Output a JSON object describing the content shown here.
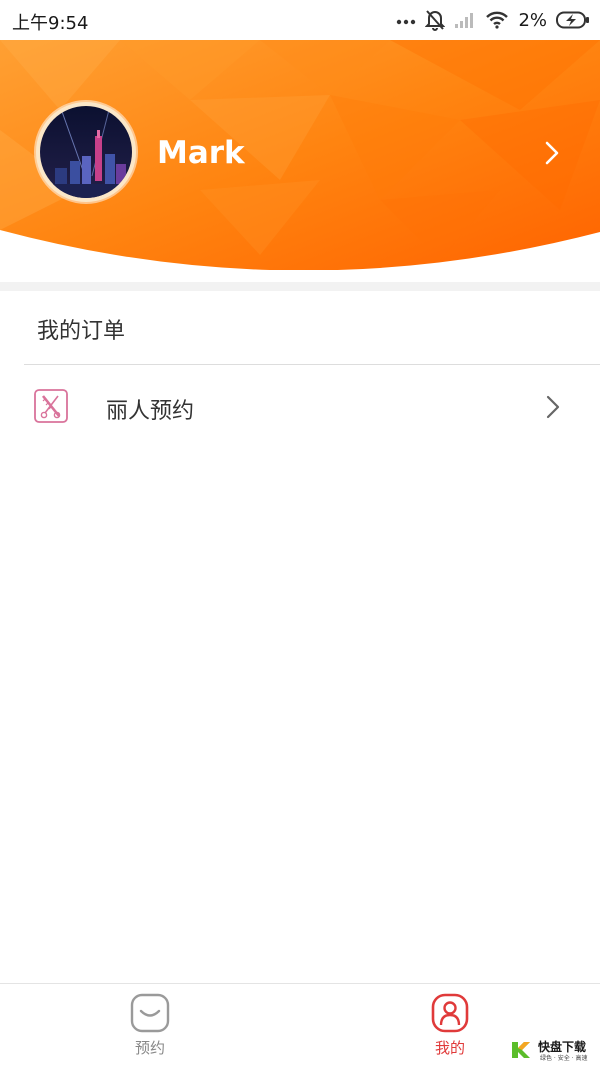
{
  "status_bar": {
    "time": "上午9:54",
    "battery": "2%"
  },
  "profile": {
    "username": "Mark"
  },
  "orders": {
    "title": "我的订单",
    "items": [
      {
        "label": "丽人预约",
        "icon": "scissors-comb-icon"
      }
    ]
  },
  "tabs": [
    {
      "label": "预约",
      "icon": "booking-icon",
      "active": false
    },
    {
      "label": "我的",
      "icon": "profile-icon",
      "active": true
    }
  ],
  "watermark": {
    "brand": "快盘下载",
    "tagline": "绿色 · 安全 · 高速"
  },
  "colors": {
    "header_orange": "#ff7a0e",
    "active_tab": "#e03a3a",
    "inactive_tab": "#888888",
    "row_icon_pink": "#d9739b"
  }
}
